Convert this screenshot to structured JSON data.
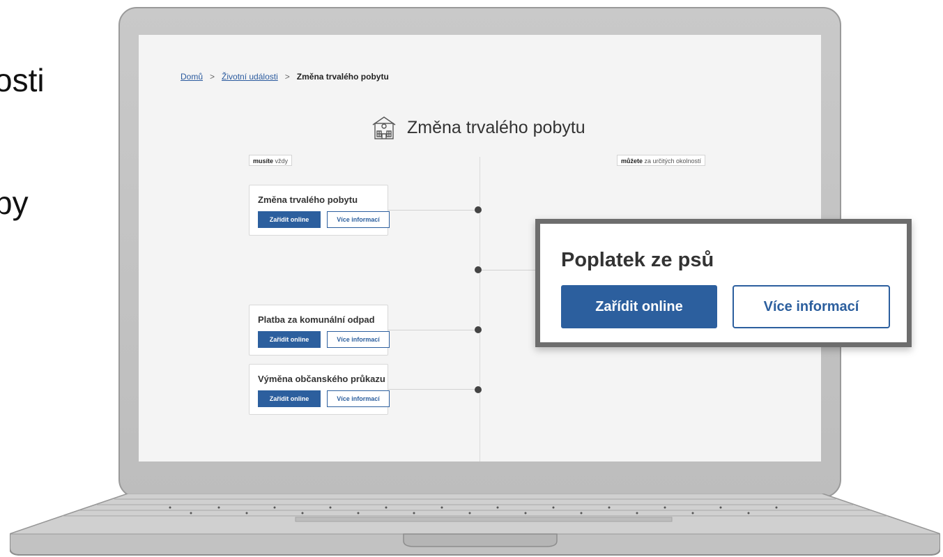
{
  "slide": {
    "text_top": "osti",
    "text_bottom": "by"
  },
  "breadcrumb": {
    "home": "Domů",
    "separator": ">",
    "parent": "Životní události",
    "current": "Změna trvalého pobytu"
  },
  "page": {
    "title": "Změna trvalého pobytu",
    "title_icon": "house-icon"
  },
  "columns": {
    "left_bold": "musíte",
    "left_rest": " vždy",
    "right_bold": "můžete",
    "right_rest": " za určitých okolností"
  },
  "cards": [
    {
      "title": "Změna trvalého pobytu",
      "primary": "Zařídit online",
      "secondary": "Více informací"
    },
    {
      "title": "Platba za komunální odpad",
      "primary": "Zařídit online",
      "secondary": "Více informací"
    },
    {
      "title": "Výměna občanského průkazu",
      "primary": "Zařídit online",
      "secondary": "Více informací"
    }
  ],
  "zoom_card": {
    "title": "Poplatek ze psů",
    "primary": "Zařídit online",
    "secondary": "Více informací"
  },
  "colors": {
    "primary": "#2c5f9e",
    "screen_bg": "#f4f4f4",
    "device": "#c4c4c4"
  }
}
